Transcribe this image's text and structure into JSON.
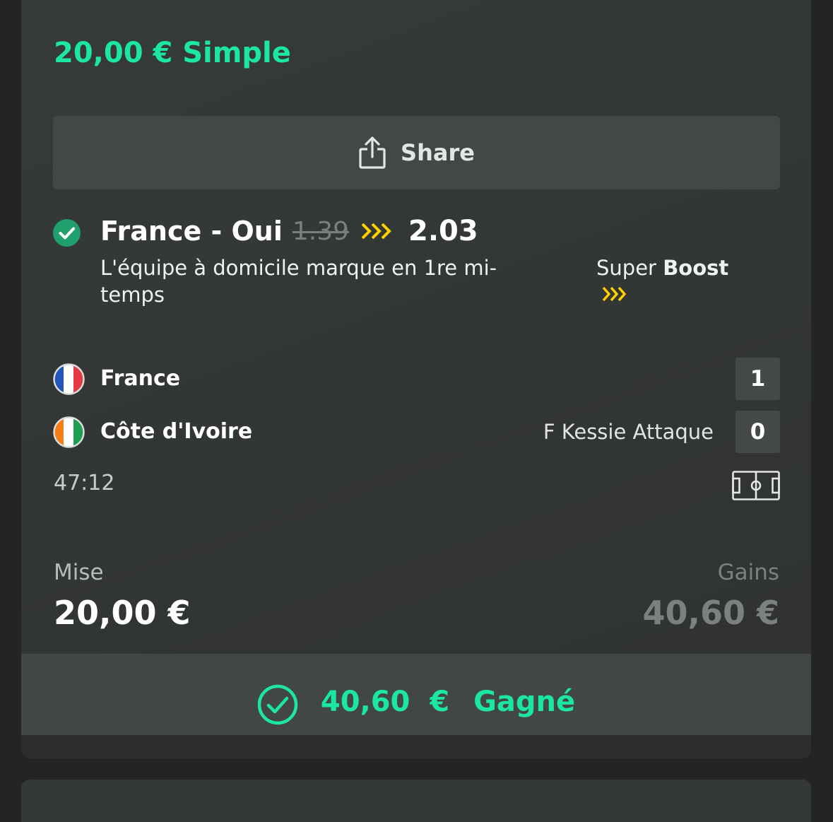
{
  "bet": {
    "title": "20,00 € Simple",
    "share_label": "Share"
  },
  "selection": {
    "name": "France - Oui",
    "old_odds": "1.39",
    "new_odds": "2.03",
    "market": "L'équipe à domicile marque en 1re mi-temps",
    "boost_prefix": "Super",
    "boost_word": "Boost"
  },
  "match": {
    "home": {
      "name": "France",
      "score": "1",
      "flag": "france"
    },
    "away": {
      "name": "Côte d'Ivoire",
      "score": "0",
      "flag": "cote-d-ivoire",
      "event": "F Kessie Attaque"
    },
    "clock": "47:12"
  },
  "stake": {
    "label": "Mise",
    "value": "20,00 €"
  },
  "gains": {
    "label": "Gains",
    "value": "40,60 €"
  },
  "result": {
    "amount": "40,60  €",
    "status": "Gagné"
  },
  "colors": {
    "accent": "#1ce6a4",
    "boost": "#ffd200",
    "won_check": "#1fa06d"
  }
}
